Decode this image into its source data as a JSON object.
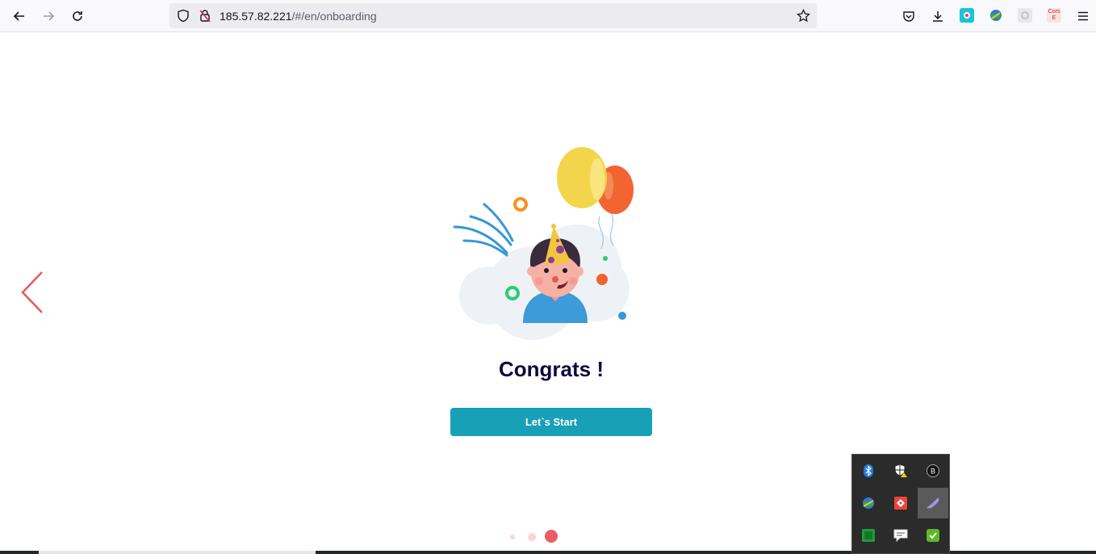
{
  "browser": {
    "url_host": "185.57.82.221",
    "url_path": "/#/en/onboarding",
    "extension_badge_text": "Cors E"
  },
  "onboarding": {
    "title": "Congrats !",
    "start_button_label": "Let`s Start",
    "steps_total": 3,
    "active_step": 3
  },
  "colors": {
    "accent": "#17a0b6",
    "title": "#0d0b3a",
    "arrow": "#e45a5a",
    "dot_active": "#ec5c63",
    "dot_inactive": "#fbd3d5"
  },
  "tray_icons": [
    "bluetooth-icon",
    "security-warning-icon",
    "app-b-icon",
    "network-globe-icon",
    "anydesk-icon",
    "feather-icon",
    "green-app-icon",
    "chat-icon",
    "check-shield-icon"
  ]
}
